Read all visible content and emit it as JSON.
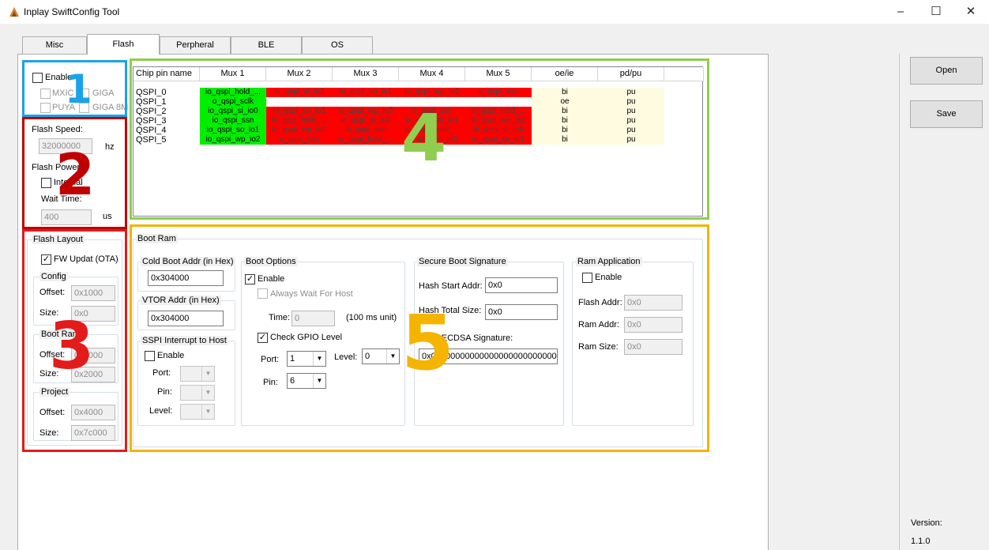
{
  "window": {
    "title": "Inplay SwiftConfig Tool",
    "min": "–",
    "max": "☐",
    "close": "✕"
  },
  "tabs": [
    "Misc",
    "Flash",
    "Perpheral",
    "BLE",
    "OS"
  ],
  "right": {
    "open": "Open",
    "save": "Save",
    "version_label": "Version:",
    "version": "1.1.0"
  },
  "chip": {
    "enable": "Enable",
    "mxic": "MXIC",
    "giga": "GIGA",
    "puya": "PUYA",
    "giga8m": "GIGA 8M"
  },
  "flash_speed": {
    "label": "Flash Speed:",
    "value": "32000000",
    "unit": "hz"
  },
  "flash_power": {
    "label": "Flash Power:",
    "internal": "Internal",
    "wait_label": "Wait Time:",
    "wait_value": "400",
    "unit": "us"
  },
  "layout": {
    "title": "Flash Layout",
    "fw_update": "FW Updat (OTA)",
    "config": {
      "title": "Config",
      "offset_label": "Offset:",
      "offset": "0x1000",
      "size_label": "Size:",
      "size": "0x0"
    },
    "bootram": {
      "title": "Boot Ram",
      "offset_label": "Offset:",
      "offset": "0x3000",
      "size_label": "Size:",
      "size": "0x2000"
    },
    "project": {
      "title": "Project",
      "offset_label": "Offset:",
      "offset": "0x4000",
      "size_label": "Size:",
      "size": "0x7c000"
    }
  },
  "table": {
    "headers": [
      "Chip pin name",
      "Mux 1",
      "Mux 2",
      "Mux 3",
      "Mux 4",
      "Mux 5",
      "oe/ie",
      "pd/pu"
    ],
    "rows": [
      [
        "QSPI_0",
        "io_qspi_hold_...",
        "io_qspi_si_io0",
        "io_qspi_so_io1",
        "io_qspi_wp_io2",
        "o_qspi_ssn",
        "bi",
        "pu"
      ],
      [
        "QSPI_1",
        "o_qspi_sclk",
        "",
        "",
        "",
        "",
        "oe",
        "pu"
      ],
      [
        "QSPI_2",
        "io_qspi_si_io0",
        "io_qspi_so_io1",
        "io_qspi_wp_io2",
        "o_qspi_ssn",
        "io_qspi_hold_...",
        "bi",
        "pu"
      ],
      [
        "QSPI_3",
        "io_qspi_ssn",
        "io_qspi_hold_...",
        "io_qspi_si_io0",
        "io_qspi_so_io1",
        "io_qspi_wp_io2",
        "bi",
        "pu"
      ],
      [
        "QSPI_4",
        "io_qspi_so_io1",
        "io_qspi_wp_io2",
        "io_qspi_ssn",
        "io_qspi_hold_...",
        "io_qspi_si_io0",
        "bi",
        "pu"
      ],
      [
        "QSPI_5",
        "io_qspi_wp_io2",
        "o_qspi_ssn",
        "io_qspi_hold_...",
        "io_qspi_si_io0",
        "io_qspi_so_io1",
        "bi",
        "pu"
      ]
    ],
    "colors": {
      "selected": "#00ee00",
      "conflict": "#ff0000",
      "attr": "#fffbe0"
    }
  },
  "bootram": {
    "title": "Boot Ram",
    "cold_boot": {
      "title": "Cold Boot Addr (in Hex)",
      "value": "0x304000"
    },
    "vtor": {
      "title": "VTOR Addr (in Hex)",
      "value": "0x304000"
    },
    "sspi": {
      "title": "SSPI Interrupt to Host",
      "enable": "Enable",
      "port": "Port:",
      "pin": "Pin:",
      "level": "Level:"
    },
    "boot_options": {
      "title": "Boot Options",
      "enable": "Enable",
      "always_wait": "Always Wait For Host",
      "time_label": "Time:",
      "time_value": "0",
      "time_unit": "(100 ms unit)",
      "check_gpio": "Check GPIO Level",
      "port_label": "Port:",
      "port_value": "1",
      "level_label": "Level:",
      "level_value": "0",
      "pin_label": "Pin:",
      "pin_value": "6"
    },
    "secure": {
      "title": "Secure Boot Signature",
      "hash_start_label": "Hash Start Addr:",
      "hash_start": "0x0",
      "hash_total_label": "Hash Total Size:",
      "hash_total": "0x0",
      "ecdsa_label": "Hash ECDSA Signature:",
      "ecdsa": "0x00000000000000000000000000000000"
    },
    "ram_app": {
      "title": "Ram Application",
      "enable": "Enable",
      "flash_label": "Flash Addr:",
      "flash": "0x0",
      "ram_label": "Ram Addr:",
      "ram": "0x0",
      "size_label": "Ram Size:",
      "size": "0x0"
    }
  },
  "annotations": [
    {
      "number": "1",
      "color": "#1aa3e8"
    },
    {
      "number": "2",
      "color": "#c00000"
    },
    {
      "number": "3",
      "color": "#e41b1b"
    },
    {
      "number": "4",
      "color": "#8fce4e"
    },
    {
      "number": "5",
      "color": "#f4b400"
    }
  ]
}
